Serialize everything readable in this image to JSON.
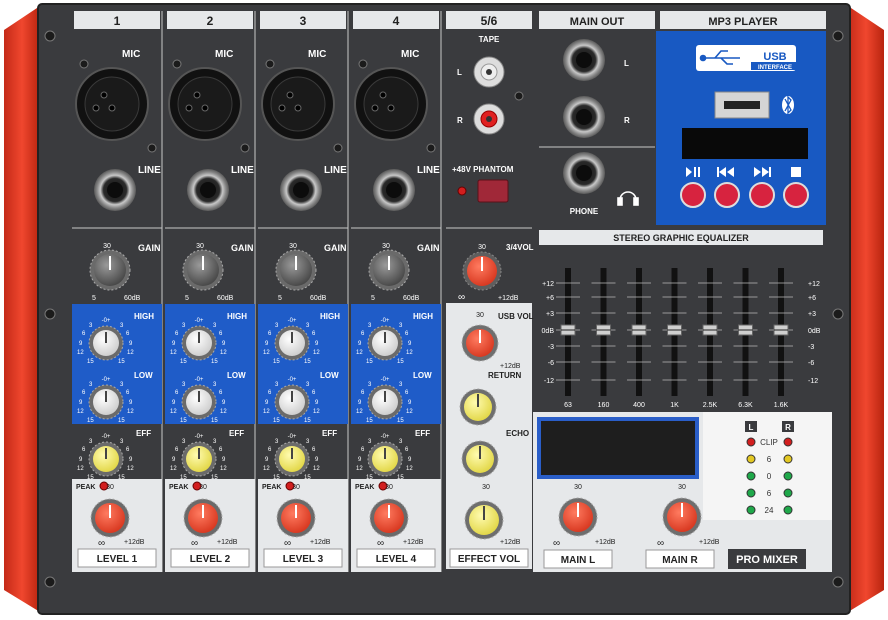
{
  "channels": [
    {
      "number": "1",
      "mic_label": "MIC",
      "line_label": "LINE",
      "gain_label": "GAIN",
      "gain_min": "5",
      "gain_mid": "30",
      "gain_max": "60dB",
      "high_label": "HIGH",
      "low_label": "LOW",
      "eff_label": "EFF",
      "peak_label": "PEAK",
      "level_label": "LEVEL 1"
    },
    {
      "number": "2",
      "mic_label": "MIC",
      "line_label": "LINE",
      "gain_label": "GAIN",
      "gain_min": "5",
      "gain_mid": "30",
      "gain_max": "60dB",
      "high_label": "HIGH",
      "low_label": "LOW",
      "eff_label": "EFF",
      "peak_label": "PEAK",
      "level_label": "LEVEL 2"
    },
    {
      "number": "3",
      "mic_label": "MIC",
      "line_label": "LINE",
      "gain_label": "GAIN",
      "gain_min": "5",
      "gain_mid": "30",
      "gain_max": "60dB",
      "high_label": "HIGH",
      "low_label": "LOW",
      "eff_label": "EFF",
      "peak_label": "PEAK",
      "level_label": "LEVEL 3"
    },
    {
      "number": "4",
      "mic_label": "MIC",
      "line_label": "LINE",
      "gain_label": "GAIN",
      "gain_min": "5",
      "gain_mid": "30",
      "gain_max": "60dB",
      "high_label": "HIGH",
      "low_label": "LOW",
      "eff_label": "EFF",
      "peak_label": "PEAK",
      "level_label": "LEVEL 4"
    }
  ],
  "eq_scale": {
    "center": "-0+",
    "left_top": "3",
    "right_top": "3",
    "l2": "6",
    "r2": "6",
    "l3": "9",
    "r3": "9",
    "l4": "12",
    "r4": "12",
    "bottom_l": "15",
    "bottom_r": "15"
  },
  "level_scale": {
    "top": "30",
    "min": "∞",
    "max": "+12dB"
  },
  "ch56": {
    "number": "5/6",
    "tape_label": "TAPE",
    "left": "L",
    "right": "R",
    "phantom_label": "+48V  PHANTOM",
    "vol_label": "3/4VOL",
    "vol_top": "30",
    "vol_min": "∞",
    "vol_max": "+12dB",
    "usb_vol_label": "USB VOL",
    "usb_top": "30",
    "usb_max": "+12dB",
    "return_label": "RETURN",
    "echo_label": "ECHO",
    "effect_top": "30",
    "effect_max": "+12dB",
    "effect_vol_label": "EFFECT VOL"
  },
  "main_out": {
    "title": "MAIN OUT",
    "left": "L",
    "right": "R",
    "phone_label": "PHONE"
  },
  "mp3": {
    "title": "MP3 PLAYER",
    "usb_logo": "USB",
    "usb_sub": "INTERFACE",
    "bluetooth": "bluetooth-icon"
  },
  "geq": {
    "title": "STEREO GRAPHIC EQUALIZER",
    "scale": [
      "+12",
      "+6",
      "+3",
      "0dB",
      "-3",
      "-6",
      "-12"
    ],
    "bands": [
      "63",
      "160",
      "400",
      "1K",
      "2.5K",
      "6.3K",
      "1.6K"
    ],
    "gains_db": [
      0,
      0,
      0,
      0,
      0,
      0,
      0
    ]
  },
  "meter": {
    "l": "L",
    "r": "R",
    "levels": [
      "CLIP",
      "6",
      "0",
      "6",
      "24"
    ]
  },
  "main_l": {
    "top": "30",
    "min": "∞",
    "max": "+12dB",
    "label": "MAIN L"
  },
  "main_r": {
    "top": "30",
    "min": "∞",
    "max": "+12dB",
    "label": "MAIN R"
  },
  "brand": "PRO MIXER",
  "colors": {
    "panel": "#3a3b3e",
    "side": "#e23a26",
    "eq_blue": "#1f5cc8",
    "mp3_blue": "#1859c2",
    "light": "#e6e8ea"
  }
}
